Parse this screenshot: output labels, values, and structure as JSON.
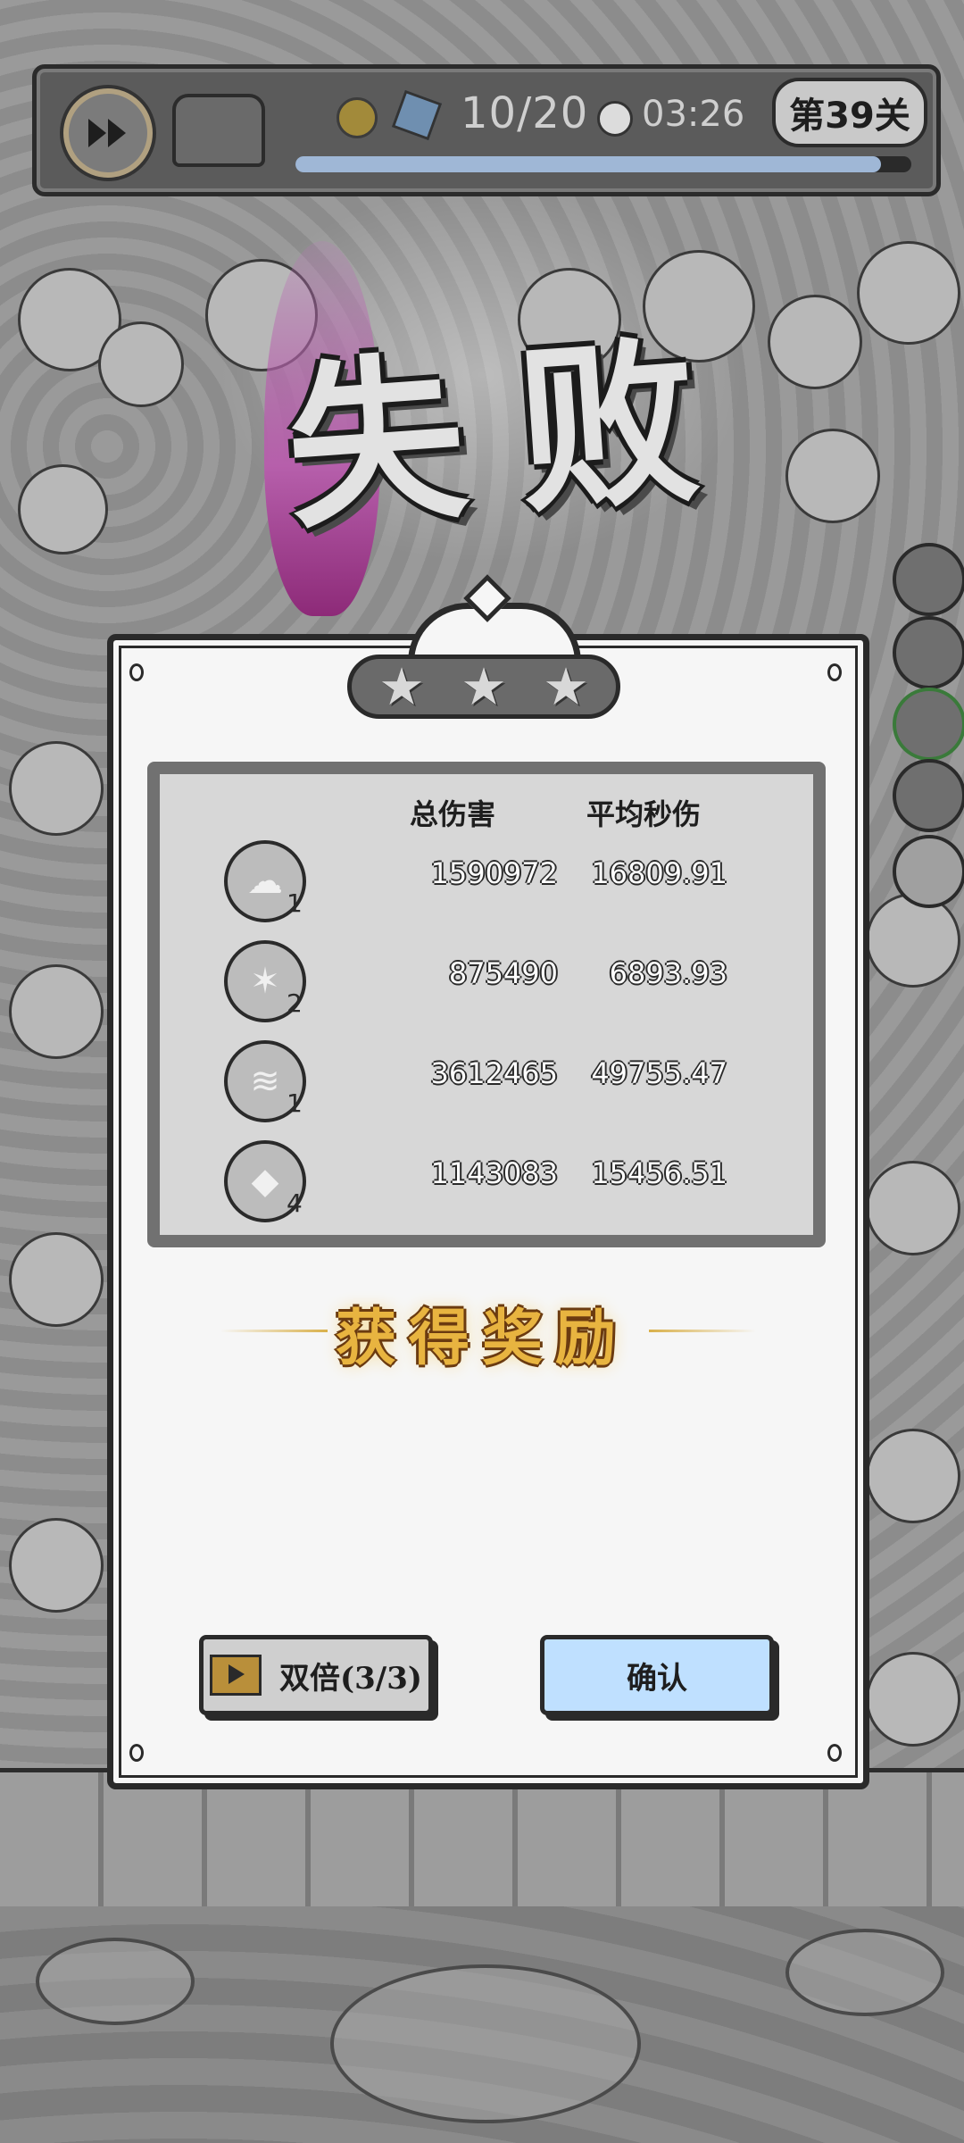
{
  "hud": {
    "resource_count": "10/20",
    "timer": "03:26",
    "level": "第39关",
    "progress_fraction": 0.95
  },
  "title": "失败",
  "result": {
    "stars_earned": 0,
    "stars_total": 3,
    "header_total_damage": "总伤害",
    "header_avg_dps": "平均秒伤",
    "rows": [
      {
        "icon": "spirit-icon",
        "level": "1",
        "total": "1590972",
        "dps": "16809.91"
      },
      {
        "icon": "crystal-icon",
        "level": "2",
        "total": "875490",
        "dps": "6893.93"
      },
      {
        "icon": "tornado-icon",
        "level": "1",
        "total": "3612465",
        "dps": "49755.47"
      },
      {
        "icon": "rock-icon",
        "level": "4",
        "total": "1143083",
        "dps": "15456.51"
      }
    ],
    "reward_title": "获得奖励",
    "double_label": "双倍(3/3)",
    "confirm_label": "确认"
  },
  "colors": {
    "confirm_bg": "#bfe0ff",
    "reward_gold": "#e8b440",
    "flame": "#b65fab"
  }
}
